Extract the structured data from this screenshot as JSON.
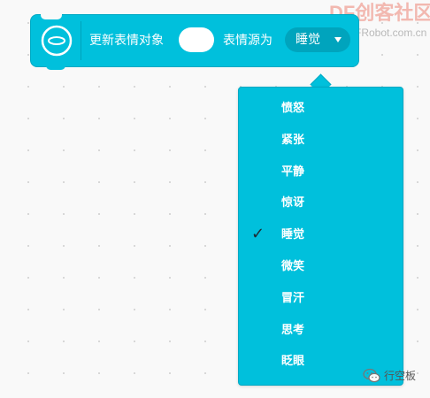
{
  "block": {
    "icon": "face-circle-icon",
    "text_update": "更新表情对象",
    "text_source": "表情源为",
    "object_value": "",
    "selected": "睡觉",
    "color": "#00c0dc"
  },
  "watermark": {
    "logo": "DF创客社区",
    "url": "mc.DFRobot.com.cn"
  },
  "dropdown": {
    "items": [
      {
        "label": "愤怒"
      },
      {
        "label": "紧张"
      },
      {
        "label": "平静"
      },
      {
        "label": "惊讶"
      },
      {
        "label": "睡觉",
        "checked": true,
        "check_mark": "✓"
      },
      {
        "label": "微笑"
      },
      {
        "label": "冒汗"
      },
      {
        "label": "思考"
      },
      {
        "label": "眨眼"
      }
    ]
  },
  "footer": {
    "icon": "wechat-icon",
    "text": "行空板"
  }
}
